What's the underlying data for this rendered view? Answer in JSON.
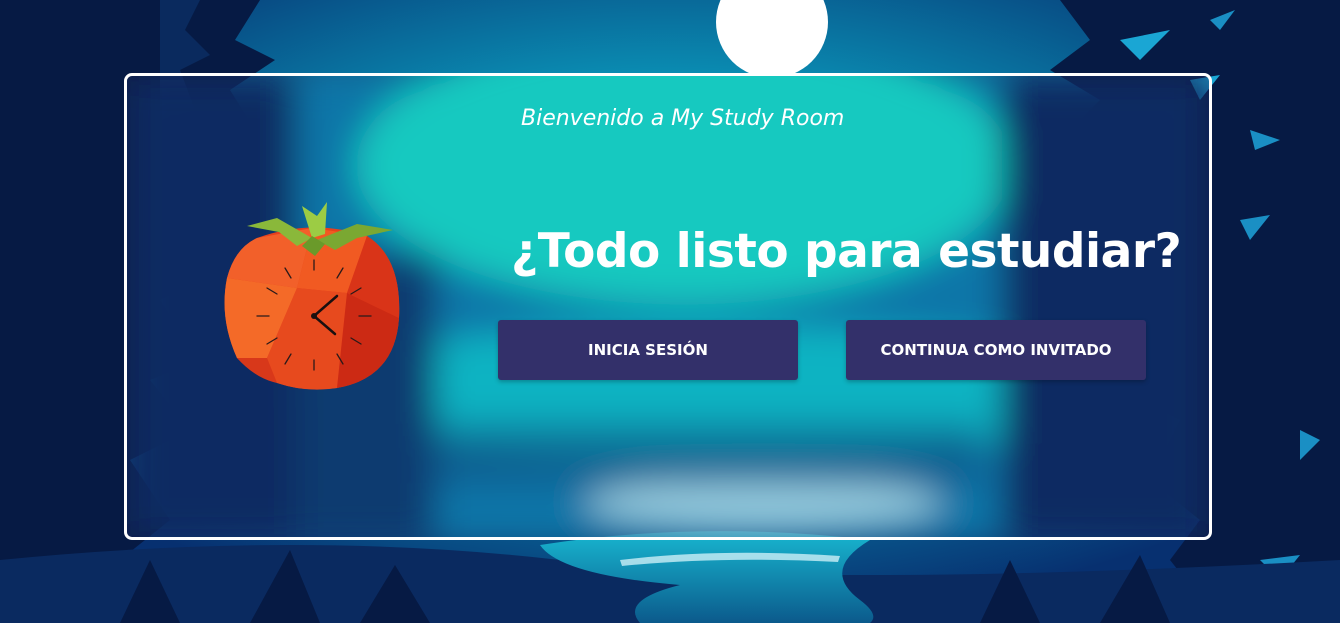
{
  "page": {
    "welcome_text": "Bienvenido a My Study Room",
    "headline": "¿Todo listo para estudiar?"
  },
  "actions": {
    "login_label": "INICIA SESIÓN",
    "guest_label": "CONTINUA COMO INVITADO"
  },
  "colors": {
    "button_bg": "#33306a",
    "card_border": "#ffffff",
    "night_dark": "#0a2050",
    "lake_teal": "#10c8c0",
    "tomato_red": "#e8401c",
    "leaf_green": "#8ab83a"
  },
  "illustration": {
    "mascot_icon": "tomato-clock-icon",
    "background": "night-forest-lake-moon"
  }
}
